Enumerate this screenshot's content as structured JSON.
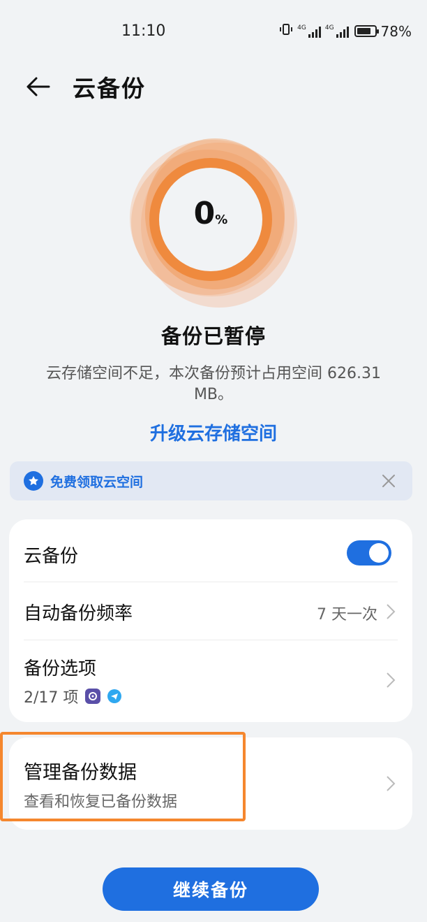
{
  "status_bar": {
    "time": "11:10",
    "net1": "4G",
    "net2": "4G",
    "battery_percent": "78%",
    "battery_level": 0.78
  },
  "header": {
    "title": "云备份",
    "back_icon": "arrow-left-icon"
  },
  "progress": {
    "value": "0",
    "unit": "%",
    "ring_color": "#f08a3c"
  },
  "backup_status": {
    "title": "备份已暂停",
    "description": "云存储空间不足，本次备份预计占用空间 626.31 MB。",
    "upgrade_link": "升级云存储空间"
  },
  "banner": {
    "text": "免费领取云空间",
    "icon": "star-badge-icon",
    "close_icon": "close-icon"
  },
  "settings": {
    "cloud_backup": {
      "label": "云备份",
      "enabled": true
    },
    "frequency": {
      "label": "自动备份频率",
      "value": "7 天一次"
    },
    "options": {
      "label": "备份选项",
      "summary": "2/17 项"
    }
  },
  "manage": {
    "title": "管理备份数据",
    "subtitle": "查看和恢复已备份数据"
  },
  "actions": {
    "continue": "继续备份"
  },
  "colors": {
    "accent": "#1f6fe0",
    "highlight": "#f5872e",
    "background": "#f1f3f5"
  }
}
